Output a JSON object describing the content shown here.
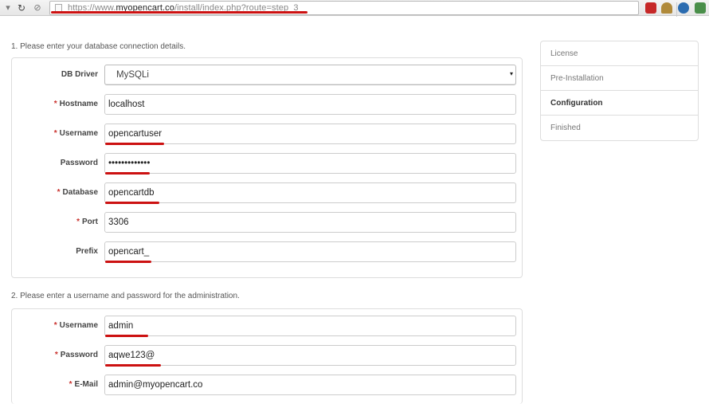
{
  "browser": {
    "url_scheme_prefix": "https://www.",
    "url_host": "myopencart.co",
    "url_path": "/install/index.php?route=step_3"
  },
  "database": {
    "section_title": "1. Please enter your database connection details.",
    "fields": [
      {
        "label": "DB Driver",
        "required": false,
        "value": "MySQLi",
        "type": "select"
      },
      {
        "label": "Hostname",
        "required": true,
        "value": "localhost",
        "type": "text"
      },
      {
        "label": "Username",
        "required": true,
        "value": "opencartuser",
        "type": "text"
      },
      {
        "label": "Password",
        "required": false,
        "value": "•••••••••••••",
        "type": "password"
      },
      {
        "label": "Database",
        "required": true,
        "value": "opencartdb",
        "type": "text"
      },
      {
        "label": "Port",
        "required": true,
        "value": "3306",
        "type": "text"
      },
      {
        "label": "Prefix",
        "required": false,
        "value": "opencart_",
        "type": "text"
      }
    ]
  },
  "admin": {
    "section_title": "2. Please enter a username and password for the administration.",
    "fields": [
      {
        "label": "Username",
        "required": true,
        "value": "admin",
        "type": "text"
      },
      {
        "label": "Password",
        "required": true,
        "value": "aqwe123@",
        "type": "text"
      },
      {
        "label": "E-Mail",
        "required": true,
        "value": "admin@myopencart.co",
        "type": "text"
      }
    ]
  },
  "steps": [
    {
      "label": "License",
      "active": false
    },
    {
      "label": "Pre-Installation",
      "active": false
    },
    {
      "label": "Configuration",
      "active": true
    },
    {
      "label": "Finished",
      "active": false
    }
  ],
  "required_marker": "*",
  "colors": {
    "accent_underline": "#cc1111",
    "required": "#c9302c"
  }
}
